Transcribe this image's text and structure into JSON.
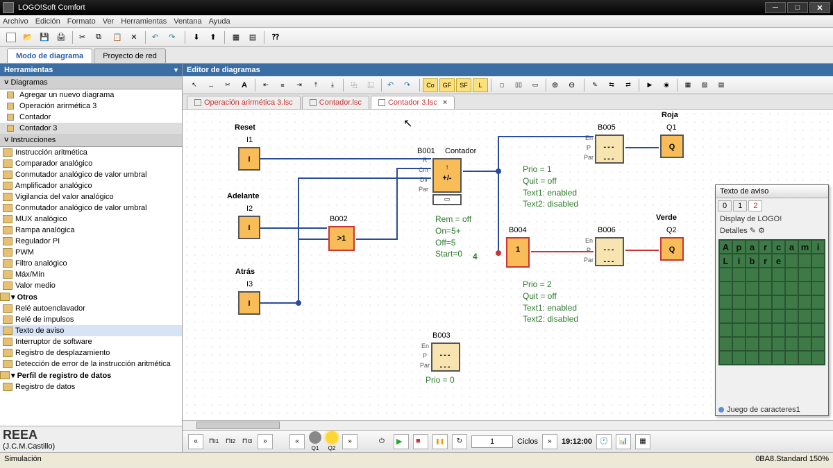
{
  "window": {
    "title": "LOGO!Soft Comfort"
  },
  "menu": [
    "Archivo",
    "Edición",
    "Formato",
    "Ver",
    "Herramientas",
    "Ventana",
    "Ayuda"
  ],
  "viewtabs": {
    "a": "Modo de diagrama",
    "b": "Proyecto de red"
  },
  "leftpanel": {
    "title": "Herramientas",
    "diagrams_hdr": "Diagramas",
    "diagrams": [
      "Agregar un nuevo diagrama",
      "Operación arirmética 3",
      "Contador",
      "Contador 3"
    ],
    "instr_hdr": "Instrucciones",
    "instr_list": [
      "Instrucción aritmética",
      "Comparador analógico",
      "Conmutador analógico de valor umbral",
      "Amplificador analógico",
      "Vigilancia del valor analógico",
      "Conmutador analógico de valor umbral",
      "MUX analógico",
      "Rampa analógica",
      "Regulador PI",
      "PWM",
      "Filtro analógico",
      "Máx/Mín",
      "Valor medio"
    ],
    "otros_hdr": "Otros",
    "otros_list": [
      "Relé autoenclavador",
      "Relé de impulsos",
      "Texto de aviso",
      "Interruptor de software",
      "Registro de desplazamiento",
      "Detección de error de la instrucción aritmética"
    ],
    "perfil_hdr": "Perfil de registro de datos",
    "perfil_list": [
      "Registro de datos"
    ],
    "watermark1": "REEA",
    "watermark2": "(J.C.M.Castillo)"
  },
  "editor": {
    "title": "Editor de diagramas",
    "doctabs": [
      "Operación arirmética 3.lsc",
      "Contador.lsc",
      "Contador 3.lsc"
    ]
  },
  "blocks": {
    "reset": "Reset",
    "i1": "I1",
    "i": "I",
    "adelante": "Adelante",
    "i2": "I2",
    "atras": "Atrás",
    "i3": "I3",
    "b002": "B002",
    "ge1": ">1",
    "b001": "B001",
    "contador": "Contador",
    "plusminus": "+/-",
    "b003": "B003",
    "b004": "B004",
    "one": "1",
    "b005": "B005",
    "b006": "B006",
    "roja": "Roja",
    "q1": "Q1",
    "q": "Q",
    "verde": "Verde",
    "q2": "Q2",
    "pins": {
      "r": "R",
      "cnt": "Cnt",
      "dir": "Dir",
      "par": "Par",
      "en": "En",
      "p": "P"
    }
  },
  "notes": {
    "cnt": "Rem = off\nOn=5+\nOff=5\nStart=0",
    "cnt_out": "4",
    "b5": "Prio = 1\nQuit = off\nText1: enabled\nText2: disabled",
    "b6": "Prio = 2\nQuit = off\nText1: enabled\nText2: disabled",
    "b3": "Prio = 0"
  },
  "floatpanel": {
    "title": "Texto de aviso",
    "tabs": [
      "0",
      "1",
      "2"
    ],
    "section": "Display de LOGO!",
    "detalles": "Detalles",
    "row1": [
      "A",
      "p",
      "a",
      "r",
      "c",
      "a",
      "m",
      "i"
    ],
    "row2": [
      "L",
      "i",
      "b",
      "r",
      "e",
      "",
      "",
      ""
    ],
    "footer": "Juego de caracteres1"
  },
  "simbar": {
    "i_labels": [
      "I1",
      "I2",
      "I3"
    ],
    "q_labels": [
      "Q1",
      "Q2"
    ],
    "cycles_val": "1",
    "cycles_lbl": "Ciclos",
    "time": "19:12:00"
  },
  "statusbar": {
    "left": "Simulación",
    "right": "0BA8.Standard 150%"
  }
}
